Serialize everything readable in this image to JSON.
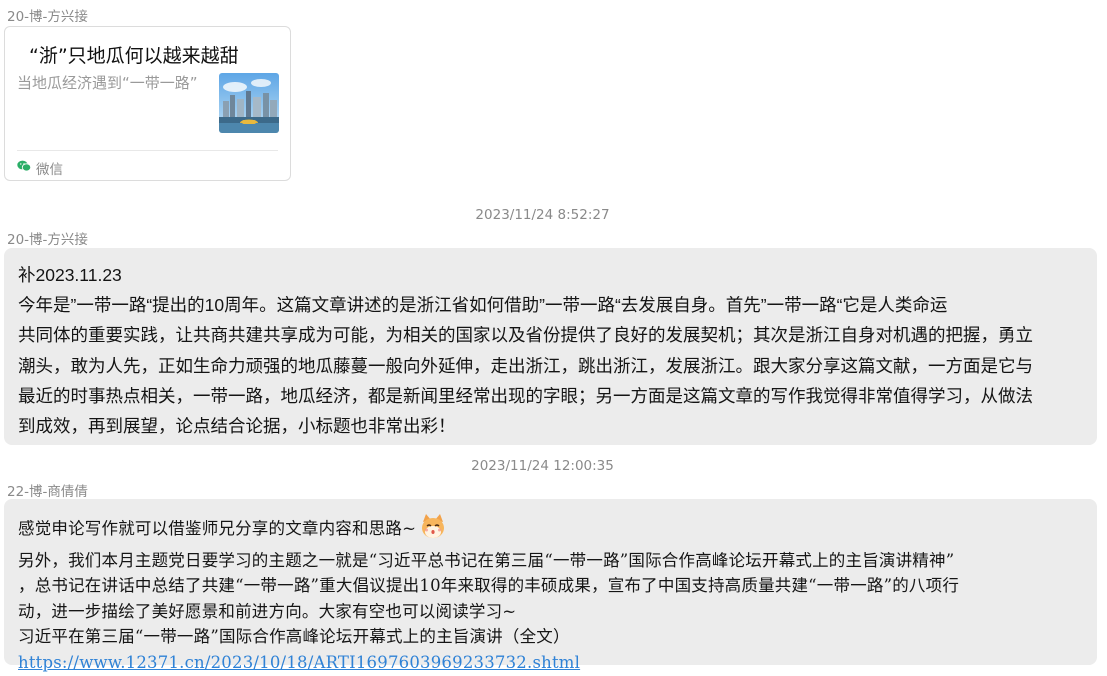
{
  "messages": {
    "m1": {
      "sender": "20-博-方兴接",
      "card": {
        "title": "“浙”只地瓜何以越来越甜",
        "description": "当地瓜经济遇到“一带一路”",
        "thumbnail_icon": "city-skyline-thumbnail",
        "source_icon": "wechat-icon",
        "source": "微信"
      }
    },
    "m2": {
      "timestamp": "2023/11/24 8:52:27",
      "sender": "20-博-方兴接",
      "lines": [
        "补2023.11.23",
        "今年是”一带一路“提出的10周年。这篇文章讲述的是浙江省如何借助”一带一路“去发展自身。首先”一带一路“它是人类命运",
        "共同体的重要实践，让共商共建共享成为可能，为相关的国家以及省份提供了良好的发展契机；其次是浙江自身对机遇的把握，勇立",
        "潮头，敢为人先，正如生命力顽强的地瓜藤蔓一般向外延伸，走出浙江，跳出浙江，发展浙江。跟大家分享这篇文献，一方面是它与",
        "最近的时事热点相关，一带一路，地瓜经济，都是新闻里经常出现的字眼；另一方面是这篇文章的写作我觉得非常值得学习，从做法",
        "到成效，再到展望，论点结合论据，小标题也非常出彩！"
      ]
    },
    "m3": {
      "timestamp": "2023/11/24 12:00:35",
      "sender": "22-博-商倩倩",
      "lines": [
        "感觉申论写作就可以借鉴师兄分享的文章内容和思路~",
        "另外，我们本月主题党日要学习的主题之一就是“习近平总书记在第三届“一带一路”国际合作高峰论坛开幕式上的主旨演讲精神”",
        "，总书记在讲话中总结了共建“一带一路”重大倡议提出10年来取得的丰硕成果，宣布了中国支持高质量共建“一带一路”的八项行",
        "动，进一步描绘了美好愿景和前进方向。大家有空也可以阅读学习~",
        "习近平在第三届“一带一路”国际合作高峰论坛开幕式上的主旨演讲（全文）"
      ],
      "link": "https://www.12371.cn/2023/10/18/ARTI1697603969233732.shtml",
      "emoji_icon": "cat-emoji-icon"
    }
  },
  "colors": {
    "bubble": "#ececec",
    "meta_text": "#8a8a8a",
    "link": "#2f82d6",
    "wechat_green": "#2aae67"
  }
}
